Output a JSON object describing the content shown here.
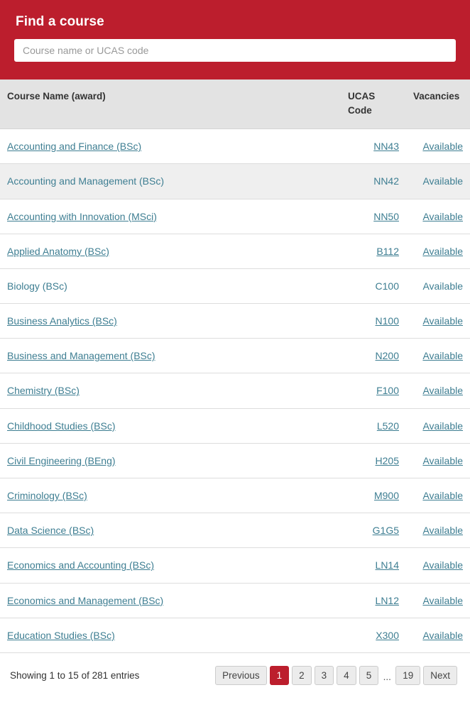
{
  "search": {
    "title": "Find a course",
    "placeholder": "Course name or UCAS code",
    "value": "",
    "banner_color": "#bc1e2d"
  },
  "table": {
    "columns": {
      "name": "Course Name (award)",
      "ucas": "UCAS Code",
      "vacancies": "Vacancies"
    },
    "link_color": "#3e7e92",
    "rows": [
      {
        "name": "Accounting and Finance (BSc)",
        "ucas": "NN43",
        "vacancies": "Available"
      },
      {
        "name": "Accounting and Management (BSc)",
        "ucas": "NN42",
        "vacancies": "Available"
      },
      {
        "name": "Accounting with Innovation (MSci)",
        "ucas": "NN50",
        "vacancies": "Available"
      },
      {
        "name": "Applied Anatomy (BSc)",
        "ucas": "B112",
        "vacancies": "Available"
      },
      {
        "name": "Biology (BSc)",
        "ucas": "C100",
        "vacancies": "Available"
      },
      {
        "name": "Business Analytics (BSc)",
        "ucas": "N100",
        "vacancies": "Available"
      },
      {
        "name": "Business and Management (BSc)",
        "ucas": "N200",
        "vacancies": "Available"
      },
      {
        "name": "Chemistry (BSc)",
        "ucas": "F100",
        "vacancies": "Available"
      },
      {
        "name": "Childhood Studies (BSc)",
        "ucas": "L520",
        "vacancies": "Available"
      },
      {
        "name": "Civil Engineering (BEng)",
        "ucas": "H205",
        "vacancies": "Available"
      },
      {
        "name": "Criminology (BSc)",
        "ucas": "M900",
        "vacancies": "Available"
      },
      {
        "name": "Data Science (BSc)",
        "ucas": "G1G5",
        "vacancies": "Available"
      },
      {
        "name": "Economics and Accounting (BSc)",
        "ucas": "LN14",
        "vacancies": "Available"
      },
      {
        "name": "Economics and Management (BSc)",
        "ucas": "LN12",
        "vacancies": "Available"
      },
      {
        "name": "Education Studies (BSc)",
        "ucas": "X300",
        "vacancies": "Available"
      }
    ]
  },
  "footer": {
    "showing": "Showing 1 to 15 of 281 entries",
    "pagination": {
      "previous": "Previous",
      "next": "Next",
      "ellipsis": "...",
      "pages": [
        "1",
        "2",
        "3",
        "4",
        "5"
      ],
      "last_page": "19",
      "active_page": "1",
      "active_color": "#bc1e2d"
    }
  }
}
